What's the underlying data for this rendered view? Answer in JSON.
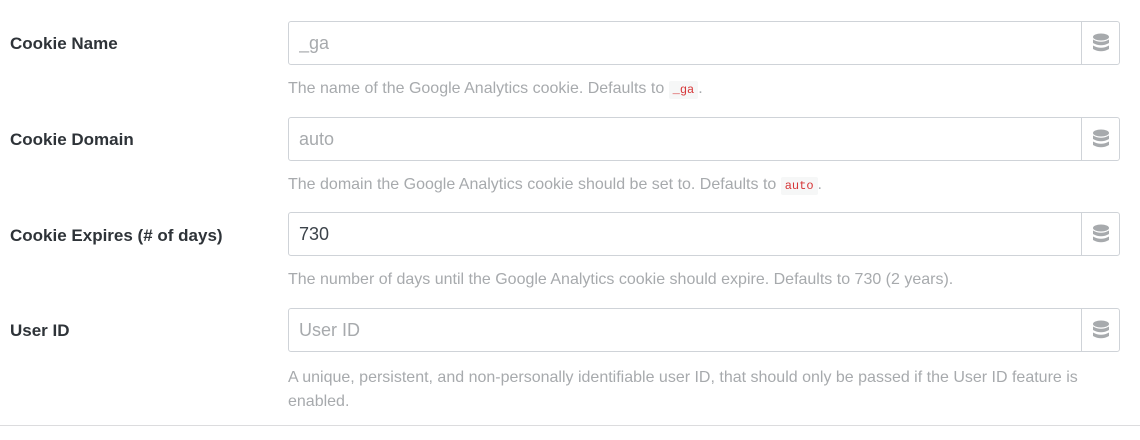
{
  "fields": [
    {
      "label": "Cookie Name",
      "value": "",
      "placeholder": "_ga",
      "help_text": "The name of the Google Analytics cookie. Defaults to ",
      "help_code": "_ga",
      "help_suffix": ".",
      "addon_icon": "database-icon"
    },
    {
      "label": "Cookie Domain",
      "value": "",
      "placeholder": "auto",
      "help_text": "The domain the Google Analytics cookie should be set to. Defaults to ",
      "help_code": "auto",
      "help_suffix": ".",
      "addon_icon": "database-icon"
    },
    {
      "label": "Cookie Expires (# of days)",
      "value": "730",
      "placeholder": "",
      "help_text": "The number of days until the Google Analytics cookie should expire. Defaults to 730 (2 years).",
      "addon_icon": "database-icon"
    },
    {
      "label": "User ID",
      "value": "",
      "placeholder": "User ID",
      "help_text": "A unique, persistent, and non-personally identifiable user ID, that should only be passed if the User ID feature is enabled.",
      "addon_icon": "database-icon"
    }
  ],
  "colors": {
    "label": "#2e3338",
    "help": "#a7aaad",
    "border": "#cfd3d8",
    "code_text": "#d63638",
    "code_bg": "#f6f7f7",
    "icon": "#a7aaad"
  }
}
